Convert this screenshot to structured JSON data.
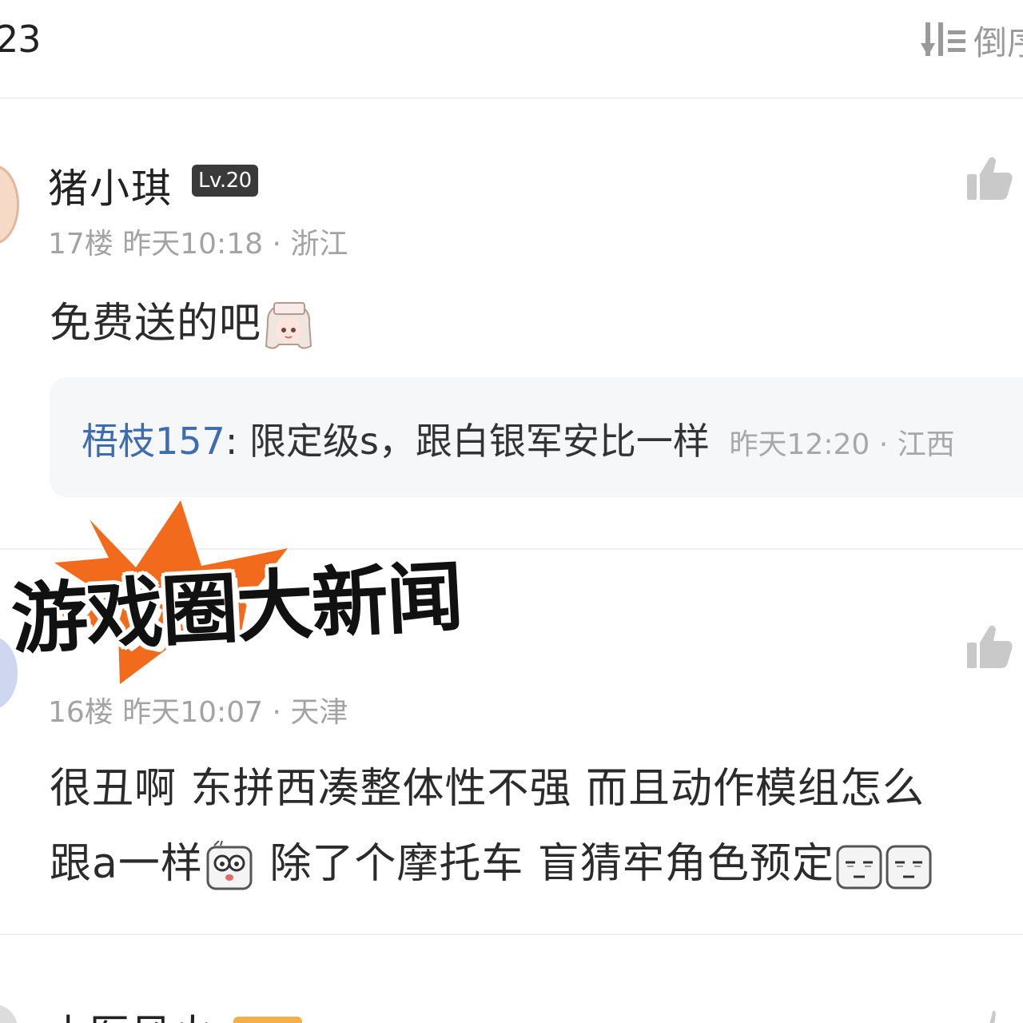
{
  "header": {
    "comment_count": "23",
    "sort_label": "倒序",
    "sort_icon": "sort-order-icon"
  },
  "comments": [
    {
      "username": "猪小琪",
      "level": "Lv.20",
      "floor_time_location": "17楼  昨天10:18 · 浙江",
      "text": "免费送的吧",
      "emoji": "cartoon-girl-emoji",
      "reply": {
        "user": "梧枝157",
        "separator": ":",
        "text": "限定级s，跟白银军安比一样",
        "meta": "昨天12:20 · 江西"
      }
    },
    {
      "username": "",
      "floor_time_location": "16楼  昨天10:07 · 天津",
      "line1": "很丑啊 东拼西凑整体性不强 而且动作模组怎么",
      "line2_a": "跟a一样",
      "line2_b": " 除了个摩托车 盲猜牢角色预定",
      "emojis": [
        "surprised-face-emoji",
        "speechless-face-emoji",
        "speechless-face-emoji"
      ]
    },
    {
      "username": "小医风火"
    }
  ],
  "overlay": {
    "title": "游戏圈大新闻",
    "burst_color": "#f26b1d"
  },
  "colors": {
    "reply_user": "#3d6db0",
    "level_badge_bg": "#3a3a3a",
    "meta_text": "#a3a3a3"
  }
}
